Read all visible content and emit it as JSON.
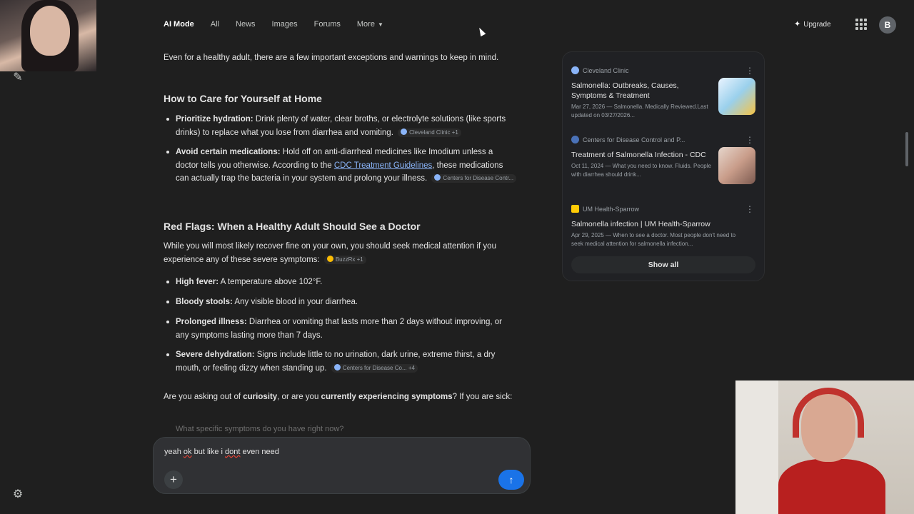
{
  "nav": {
    "tabs": [
      {
        "label": "AI Mode",
        "active": true
      },
      {
        "label": "All"
      },
      {
        "label": "News"
      },
      {
        "label": "Images"
      },
      {
        "label": "Forums"
      },
      {
        "label": "More"
      }
    ],
    "upgrade_label": "Upgrade",
    "avatar_letter": "B"
  },
  "answer": {
    "intro": "Even for a healthy adult, there are a few important exceptions and warnings to keep in mind.",
    "care_heading": "How to Care for Yourself at Home",
    "care_items": [
      {
        "bold": "Prioritize hydration:",
        "text": " Drink plenty of water, clear broths, or electrolyte solutions (like sports drinks) to replace what you lose from diarrhea and vomiting.",
        "chip": "Cleveland Clinic +1"
      },
      {
        "bold": "Avoid certain medications:",
        "text_before": " Hold off on anti-diarrheal medicines like Imodium unless a doctor tells you otherwise. According to the ",
        "link": "CDC Treatment Guidelines",
        "text_after": ", these medications can actually trap the bacteria in your system and prolong your illness.",
        "chip": "Centers for Disease Contr..."
      }
    ],
    "flags_heading": "Red Flags: When a Healthy Adult Should See a Doctor",
    "flags_intro": "While you will most likely recover fine on your own, you should seek medical attention if you experience any of these severe symptoms:",
    "flags_intro_chip": "BuzzRx +1",
    "flag_items": [
      {
        "bold": "High fever:",
        "text": " A temperature above 102°F."
      },
      {
        "bold": "Bloody stools:",
        "text": " Any visible blood in your diarrhea."
      },
      {
        "bold": "Prolonged illness:",
        "text": " Diarrhea or vomiting that lasts more than 2 days without improving, or any symptoms lasting more than 7 days."
      },
      {
        "bold": "Severe dehydration:",
        "text": " Signs include little to no urination, dark urine, extreme thirst, a dry mouth, or feeling dizzy when standing up.",
        "chip": "Centers for Disease Co... +4"
      }
    ],
    "question_pre": "Are you asking out of ",
    "question_b1": "curiosity",
    "question_mid": ", or are you ",
    "question_b2": "currently experiencing symptoms",
    "question_post": "? If you are sick:",
    "faded_line": "What specific symptoms do you have right now?"
  },
  "composer": {
    "text_pre": "yeah ",
    "text_ok": "ok",
    "text_mid": " but like i ",
    "text_dont": "dont",
    "text_post": " even need"
  },
  "sources": {
    "items": [
      {
        "site": "Cleveland Clinic",
        "title": "Salmonella: Outbreaks, Causes, Symptoms & Treatment",
        "snippet": "Mar 27, 2026 — Salmonella. Medically Reviewed.Last updated on 03/27/2026..."
      },
      {
        "site": "Centers for Disease Control and P...",
        "title": "Treatment of Salmonella Infection - CDC",
        "snippet": "Oct 11, 2024 — What you need to know. Fluids. People with diarrhea should drink..."
      },
      {
        "site": "UM Health-Sparrow",
        "title": "Salmonella infection | UM Health-Sparrow",
        "snippet": "Apr 29, 2025 — When to see a doctor. Most people don't need to seek medical attention for salmonella infection..."
      }
    ],
    "show_all_label": "Show all"
  }
}
